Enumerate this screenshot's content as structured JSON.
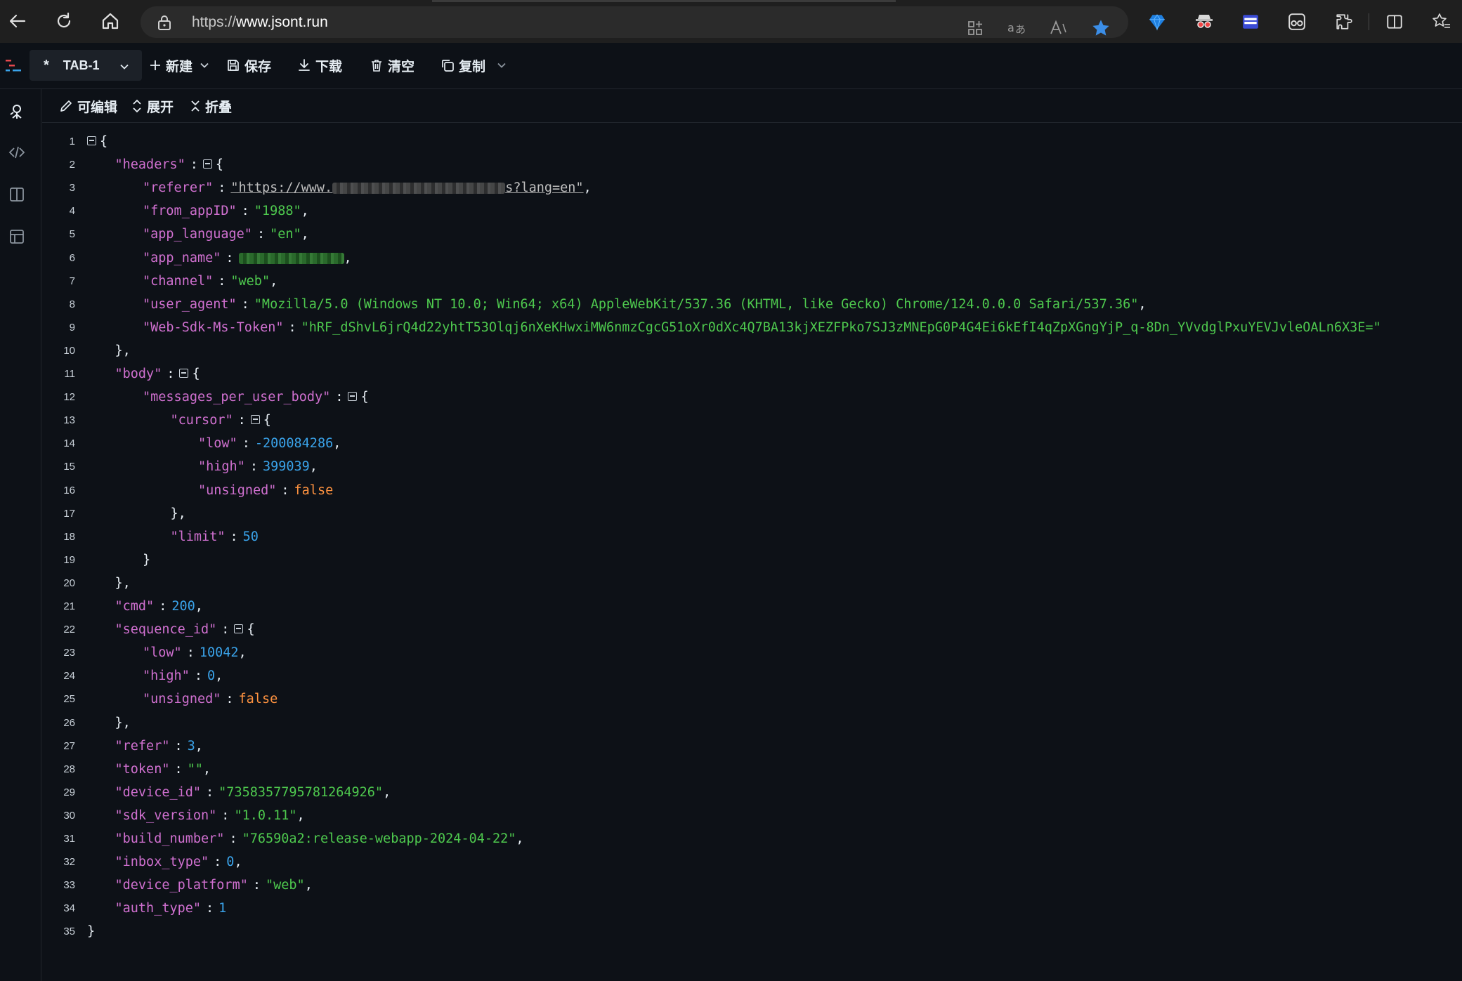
{
  "browser": {
    "url_prefix": "https://",
    "url_domain": "www.jsont.run",
    "icons": [
      "back-icon",
      "reload-icon",
      "home-icon",
      "lock-icon",
      "apps-icon",
      "translate-icon",
      "read-aloud-icon",
      "favorite-star-icon"
    ],
    "extensions": [
      "gem-extension-icon",
      "spy-extension-icon",
      "panel-extension-icon",
      "face-extension-icon",
      "puzzle-extensions-icon",
      "split-screen-icon",
      "favorites-icon"
    ]
  },
  "toolbar": {
    "tab_star": "*",
    "tab_label": "TAB-1",
    "new_label": "新建",
    "save_label": "保存",
    "download_label": "下载",
    "clear_label": "清空",
    "copy_label": "复制"
  },
  "subtoolbar": {
    "edit_label": "可编辑",
    "expand_label": "展开",
    "collapse_label": "折叠"
  },
  "rail": {
    "icons": [
      "tree-view-icon",
      "code-view-icon",
      "split-view-icon",
      "table-view-icon"
    ]
  },
  "json": {
    "lines": [
      {
        "n": "1",
        "indent": 0,
        "key": "",
        "fold": true,
        "value": "",
        "vtype": "",
        "tail": "{"
      },
      {
        "n": "2",
        "indent": 1,
        "key": "\"headers\"",
        "fold": true,
        "value": "",
        "vtype": "",
        "tail": "{"
      },
      {
        "n": "3",
        "indent": 2,
        "key": "\"referer\"",
        "fold": false,
        "value": "\"https://www.",
        "vtype": "link",
        "redacted": "gray",
        "value2": "s?lang=en\"",
        "tail": ","
      },
      {
        "n": "4",
        "indent": 2,
        "key": "\"from_appID\"",
        "fold": false,
        "value": "\"1988\"",
        "vtype": "s",
        "tail": ","
      },
      {
        "n": "5",
        "indent": 2,
        "key": "\"app_language\"",
        "fold": false,
        "value": "\"en\"",
        "vtype": "s",
        "tail": ","
      },
      {
        "n": "6",
        "indent": 2,
        "key": "\"app_name\"",
        "fold": false,
        "value": "",
        "vtype": "s",
        "redacted": "green",
        "tail": ","
      },
      {
        "n": "7",
        "indent": 2,
        "key": "\"channel\"",
        "fold": false,
        "value": "\"web\"",
        "vtype": "s",
        "tail": ","
      },
      {
        "n": "8",
        "indent": 2,
        "key": "\"user_agent\"",
        "fold": false,
        "value": "\"Mozilla/5.0 (Windows NT 10.0; Win64; x64) AppleWebKit/537.36 (KHTML, like Gecko) Chrome/124.0.0.0 Safari/537.36\"",
        "vtype": "s",
        "tail": ","
      },
      {
        "n": "9",
        "indent": 2,
        "key": "\"Web-Sdk-Ms-Token\"",
        "fold": false,
        "value": "\"hRF_dShvL6jrQ4d22yhtT53Olqj6nXeKHwxiMW6nmzCgcG51oXr0dXc4Q7BA13kjXEZFPko7SJ3zMNEpG0P4G4Ei6kEfI4qZpXGngYjP_q-8Dn_YVvdglPxuYEVJvleOALn6X3E=\"",
        "vtype": "s",
        "tail": ""
      },
      {
        "n": "10",
        "indent": 1,
        "key": "",
        "fold": false,
        "value": "",
        "vtype": "",
        "tail": "},"
      },
      {
        "n": "11",
        "indent": 1,
        "key": "\"body\"",
        "fold": true,
        "value": "",
        "vtype": "",
        "tail": "{"
      },
      {
        "n": "12",
        "indent": 2,
        "key": "\"messages_per_user_body\"",
        "fold": true,
        "value": "",
        "vtype": "",
        "tail": "{"
      },
      {
        "n": "13",
        "indent": 3,
        "key": "\"cursor\"",
        "fold": true,
        "value": "",
        "vtype": "",
        "tail": "{"
      },
      {
        "n": "14",
        "indent": 4,
        "key": "\"low\"",
        "fold": false,
        "value": "-200084286",
        "vtype": "n",
        "tail": ","
      },
      {
        "n": "15",
        "indent": 4,
        "key": "\"high\"",
        "fold": false,
        "value": "399039",
        "vtype": "n",
        "tail": ","
      },
      {
        "n": "16",
        "indent": 4,
        "key": "\"unsigned\"",
        "fold": false,
        "value": "false",
        "vtype": "b",
        "tail": ""
      },
      {
        "n": "17",
        "indent": 3,
        "key": "",
        "fold": false,
        "value": "",
        "vtype": "",
        "tail": "},"
      },
      {
        "n": "18",
        "indent": 3,
        "key": "\"limit\"",
        "fold": false,
        "value": "50",
        "vtype": "n",
        "tail": ""
      },
      {
        "n": "19",
        "indent": 2,
        "key": "",
        "fold": false,
        "value": "",
        "vtype": "",
        "tail": "}"
      },
      {
        "n": "20",
        "indent": 1,
        "key": "",
        "fold": false,
        "value": "",
        "vtype": "",
        "tail": "},"
      },
      {
        "n": "21",
        "indent": 1,
        "key": "\"cmd\"",
        "fold": false,
        "value": "200",
        "vtype": "n",
        "tail": ","
      },
      {
        "n": "22",
        "indent": 1,
        "key": "\"sequence_id\"",
        "fold": true,
        "value": "",
        "vtype": "",
        "tail": "{"
      },
      {
        "n": "23",
        "indent": 2,
        "key": "\"low\"",
        "fold": false,
        "value": "10042",
        "vtype": "n",
        "tail": ","
      },
      {
        "n": "24",
        "indent": 2,
        "key": "\"high\"",
        "fold": false,
        "value": "0",
        "vtype": "n",
        "tail": ","
      },
      {
        "n": "25",
        "indent": 2,
        "key": "\"unsigned\"",
        "fold": false,
        "value": "false",
        "vtype": "b",
        "tail": ""
      },
      {
        "n": "26",
        "indent": 1,
        "key": "",
        "fold": false,
        "value": "",
        "vtype": "",
        "tail": "},"
      },
      {
        "n": "27",
        "indent": 1,
        "key": "\"refer\"",
        "fold": false,
        "value": "3",
        "vtype": "n",
        "tail": ","
      },
      {
        "n": "28",
        "indent": 1,
        "key": "\"token\"",
        "fold": false,
        "value": "\"\"",
        "vtype": "s",
        "tail": ","
      },
      {
        "n": "29",
        "indent": 1,
        "key": "\"device_id\"",
        "fold": false,
        "value": "\"7358357795781264926\"",
        "vtype": "s",
        "tail": ","
      },
      {
        "n": "30",
        "indent": 1,
        "key": "\"sdk_version\"",
        "fold": false,
        "value": "\"1.0.11\"",
        "vtype": "s",
        "tail": ","
      },
      {
        "n": "31",
        "indent": 1,
        "key": "\"build_number\"",
        "fold": false,
        "value": "\"76590a2:release-webapp-2024-04-22\"",
        "vtype": "s",
        "tail": ","
      },
      {
        "n": "32",
        "indent": 1,
        "key": "\"inbox_type\"",
        "fold": false,
        "value": "0",
        "vtype": "n",
        "tail": ","
      },
      {
        "n": "33",
        "indent": 1,
        "key": "\"device_platform\"",
        "fold": false,
        "value": "\"web\"",
        "vtype": "s",
        "tail": ","
      },
      {
        "n": "34",
        "indent": 1,
        "key": "\"auth_type\"",
        "fold": false,
        "value": "1",
        "vtype": "n",
        "tail": ""
      },
      {
        "n": "35",
        "indent": 0,
        "key": "",
        "fold": false,
        "value": "",
        "vtype": "",
        "tail": "}"
      }
    ]
  }
}
